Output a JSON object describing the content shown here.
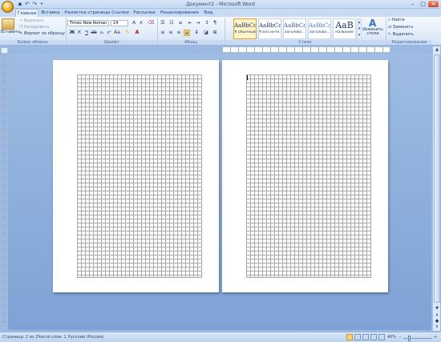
{
  "window": {
    "title": "Документ2 - Microsoft Word"
  },
  "tabs": [
    "Главная",
    "Вставка",
    "Разметка страницы",
    "Ссылки",
    "Рассылки",
    "Рецензирование",
    "Вид"
  ],
  "clipboard": {
    "paste": "Вставить",
    "cut": "Вырезать",
    "copy": "Копировать",
    "format_painter": "Формат по образцу",
    "label": "Буфер обмена"
  },
  "font": {
    "name": "Times New Roman",
    "size": "14",
    "label": "Шрифт"
  },
  "paragraph": {
    "label": "Абзац"
  },
  "styles": {
    "items": [
      {
        "preview": "AaBbCcI",
        "name": "¶ Обычный"
      },
      {
        "preview": "AaBbCcI",
        "name": "¶ Без инте..."
      },
      {
        "preview": "AaBbCc",
        "name": "Заголово..."
      },
      {
        "preview": "AaBbCc",
        "name": "Заголово..."
      },
      {
        "preview": "AaB",
        "name": "Название"
      }
    ],
    "change": "Изменить стили",
    "label": "Стили"
  },
  "editing": {
    "find": "Найти",
    "replace": "Заменить",
    "select": "Выделить",
    "label": "Редактирование"
  },
  "status": {
    "page": "Страница: 2 из 2",
    "words": "Число слов: 1",
    "lang": "Русский (Россия)",
    "zoom": "40%"
  },
  "colors": {
    "accent": "#15428b",
    "grid": "#a8a8a8",
    "workspace": "#8caedd"
  }
}
